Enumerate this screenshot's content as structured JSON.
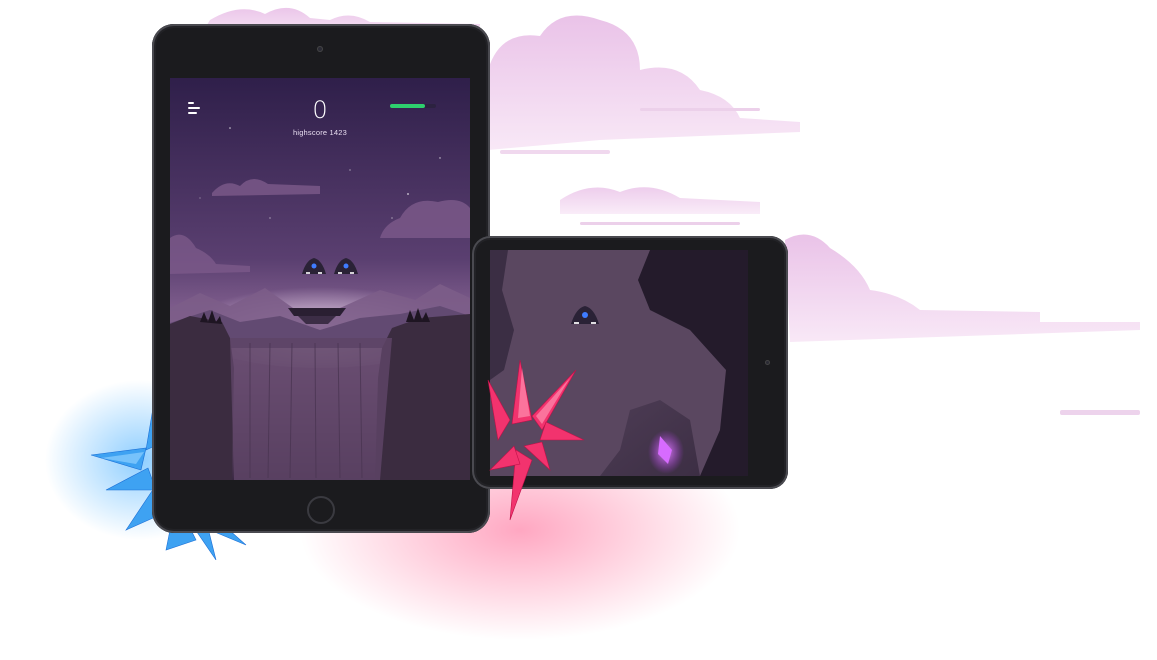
{
  "hud": {
    "score": "0",
    "highscore_label": "highscore 1423",
    "health_level": 0.75
  },
  "colors": {
    "sky_top": "#2f1f4a",
    "sky_bottom": "#a27aa8",
    "cliff": "#3b2c40",
    "health": "#2ed06e",
    "crystal_blue": "#3fa6f2",
    "crystal_pink": "#f2336e",
    "cloud": "#e9c7e8",
    "meteor": "#c23cff"
  },
  "icons": {
    "menu": "menu-icon",
    "ship": "spaceship-icon"
  }
}
